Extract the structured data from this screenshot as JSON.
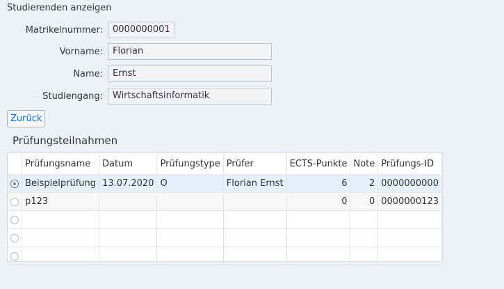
{
  "page": {
    "title": "Studierenden anzeigen"
  },
  "form": {
    "matrikel_label": "Matrikelnummer:",
    "matrikel_value": "0000000001",
    "vorname_label": "Vorname:",
    "vorname_value": "Florian",
    "name_label": "Name:",
    "name_value": "Ernst",
    "studiengang_label": "Studiengang:",
    "studiengang_value": "Wirtschaftsinformatik"
  },
  "buttons": {
    "back_label": "Zurück"
  },
  "section": {
    "title": "Prüfungsteilnahmen"
  },
  "table": {
    "headers": [
      "Prüfungsname",
      "Datum",
      "Prüfungstype",
      "Prüfer",
      "ECTS-Punkte",
      "Note",
      "Prüfungs-ID"
    ],
    "rows": [
      {
        "selected": true,
        "cells": [
          "Beispielprüfung",
          "13.07.2020",
          "O",
          "Florian Ernst",
          "6",
          "2",
          "0000000000"
        ]
      },
      {
        "selected": false,
        "cells": [
          "p123",
          "",
          "",
          "",
          "0",
          "0",
          "0000000123"
        ]
      },
      {
        "selected": false,
        "cells": [
          "",
          "",
          "",
          "",
          "",
          "",
          ""
        ]
      },
      {
        "selected": false,
        "cells": [
          "",
          "",
          "",
          "",
          "",
          "",
          ""
        ]
      },
      {
        "selected": false,
        "cells": [
          "",
          "",
          "",
          "",
          "",
          "",
          ""
        ]
      }
    ]
  },
  "colors": {
    "accent": "#0a6ed1",
    "selected_row": "#e5f0fa",
    "background": "#edf0f4"
  }
}
